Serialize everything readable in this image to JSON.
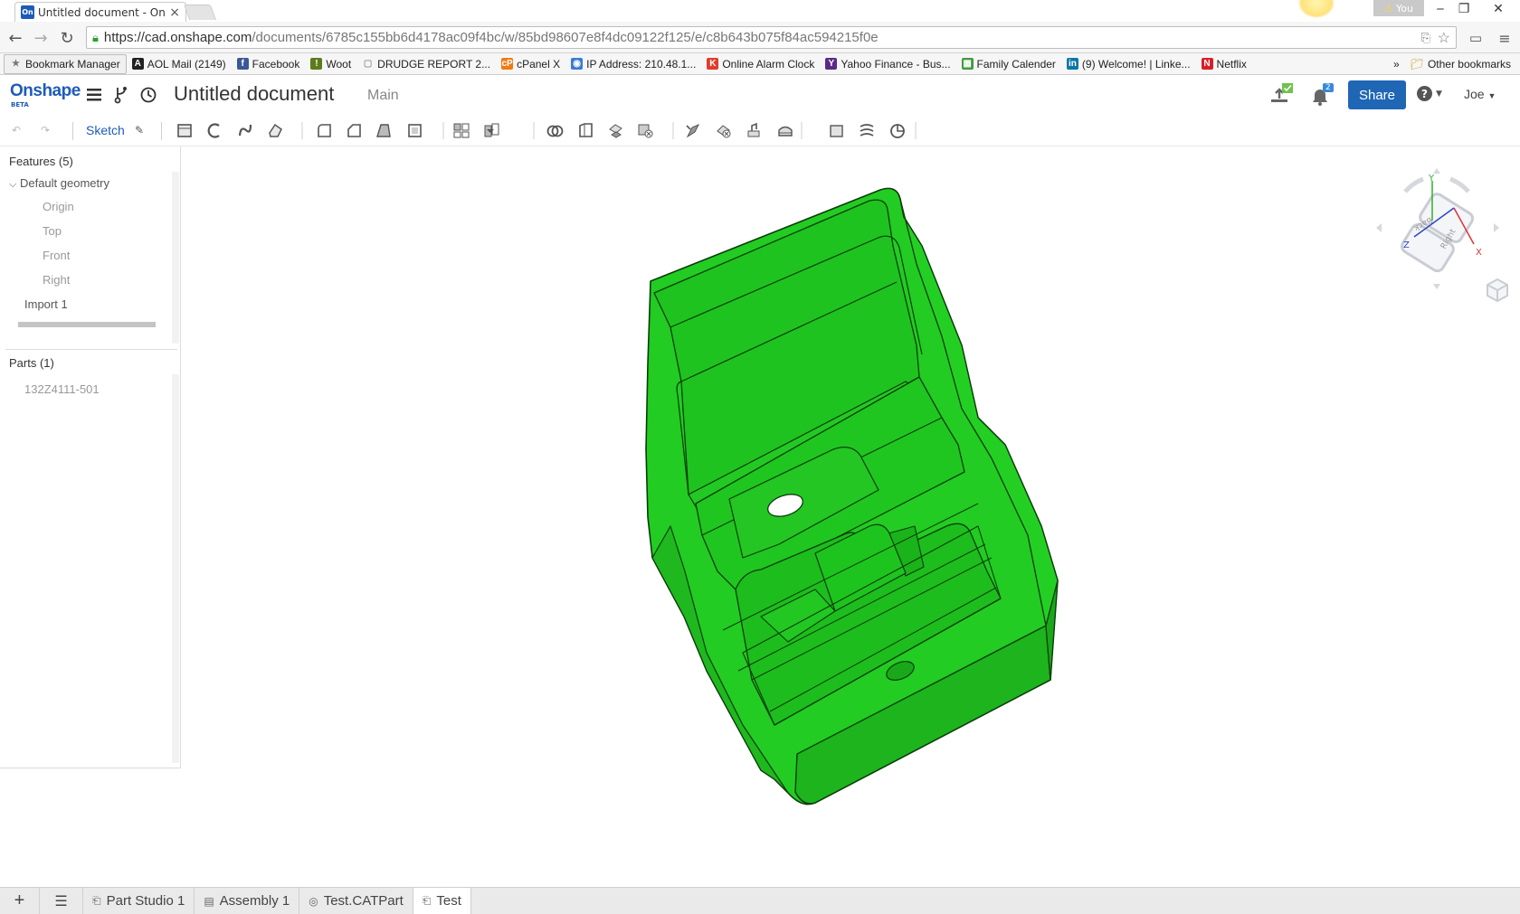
{
  "browser": {
    "tab_title": "Untitled document - Onsh",
    "tab_close": "×",
    "profile_name": "You",
    "url_host": "https://cad.onshape.com",
    "url_path": "/documents/6785c155bb6d4178ac09f4bc/w/85bd98607e8f4dc09122f125/e/c8b643b075f84ac594215f0e",
    "bookmarks": [
      {
        "label": "Bookmark Manager",
        "icon": "★",
        "color": "#777777"
      },
      {
        "label": "AOL Mail (2149)",
        "icon": "A",
        "color": "#222222"
      },
      {
        "label": "Facebook",
        "icon": "f",
        "color": "#3b5998"
      },
      {
        "label": "Woot",
        "icon": "!",
        "color": "#5a7d1a"
      },
      {
        "label": "DRUDGE REPORT 2...",
        "icon": "▢",
        "color": "#999999"
      },
      {
        "label": "cPanel X",
        "icon": "cP",
        "color": "#f07a14"
      },
      {
        "label": "IP Address: 210.48.1...",
        "icon": "◉",
        "color": "#3a7bd5"
      },
      {
        "label": "Online Alarm Clock",
        "icon": "K",
        "color": "#e23b2b"
      },
      {
        "label": "Yahoo Finance - Bus...",
        "icon": "Y",
        "color": "#5b2a86"
      },
      {
        "label": "Family Calender",
        "icon": "▦",
        "color": "#3e9b3e"
      },
      {
        "label": "(9) Welcome! | Linke...",
        "icon": "in",
        "color": "#0e76a8"
      },
      {
        "label": "Netflix",
        "icon": "N",
        "color": "#d81f26"
      }
    ],
    "overflow": "»",
    "other_bookmarks": "Other bookmarks"
  },
  "app": {
    "logo": "Onshape",
    "logo_badge": "BETA",
    "document_title": "Untitled document",
    "branch": "Main",
    "share_label": "Share",
    "notification_count": "2",
    "user": "Joe",
    "help_label": "?"
  },
  "toolbar": {
    "sketch_label": "Sketch"
  },
  "features": {
    "header": "Features (5)",
    "group": "Default geometry",
    "items": [
      "Origin",
      "Top",
      "Front",
      "Right"
    ],
    "import": "Import 1"
  },
  "parts": {
    "header": "Parts (1)",
    "items": [
      "132Z4111-501"
    ]
  },
  "view_cube": {
    "axis_x": "X",
    "axis_y": "Y",
    "axis_z": "Z",
    "face_top": "Back",
    "face_front": "Right"
  },
  "model": {
    "color": "#22cc22",
    "edge_color": "#0b3d0b"
  },
  "bottom_tabs": [
    {
      "label": "Part Studio 1",
      "icon": "⎗"
    },
    {
      "label": "Assembly 1",
      "icon": "▤"
    },
    {
      "label": "Test.CATPart",
      "icon": "◎"
    },
    {
      "label": "Test",
      "icon": "⎗"
    }
  ]
}
